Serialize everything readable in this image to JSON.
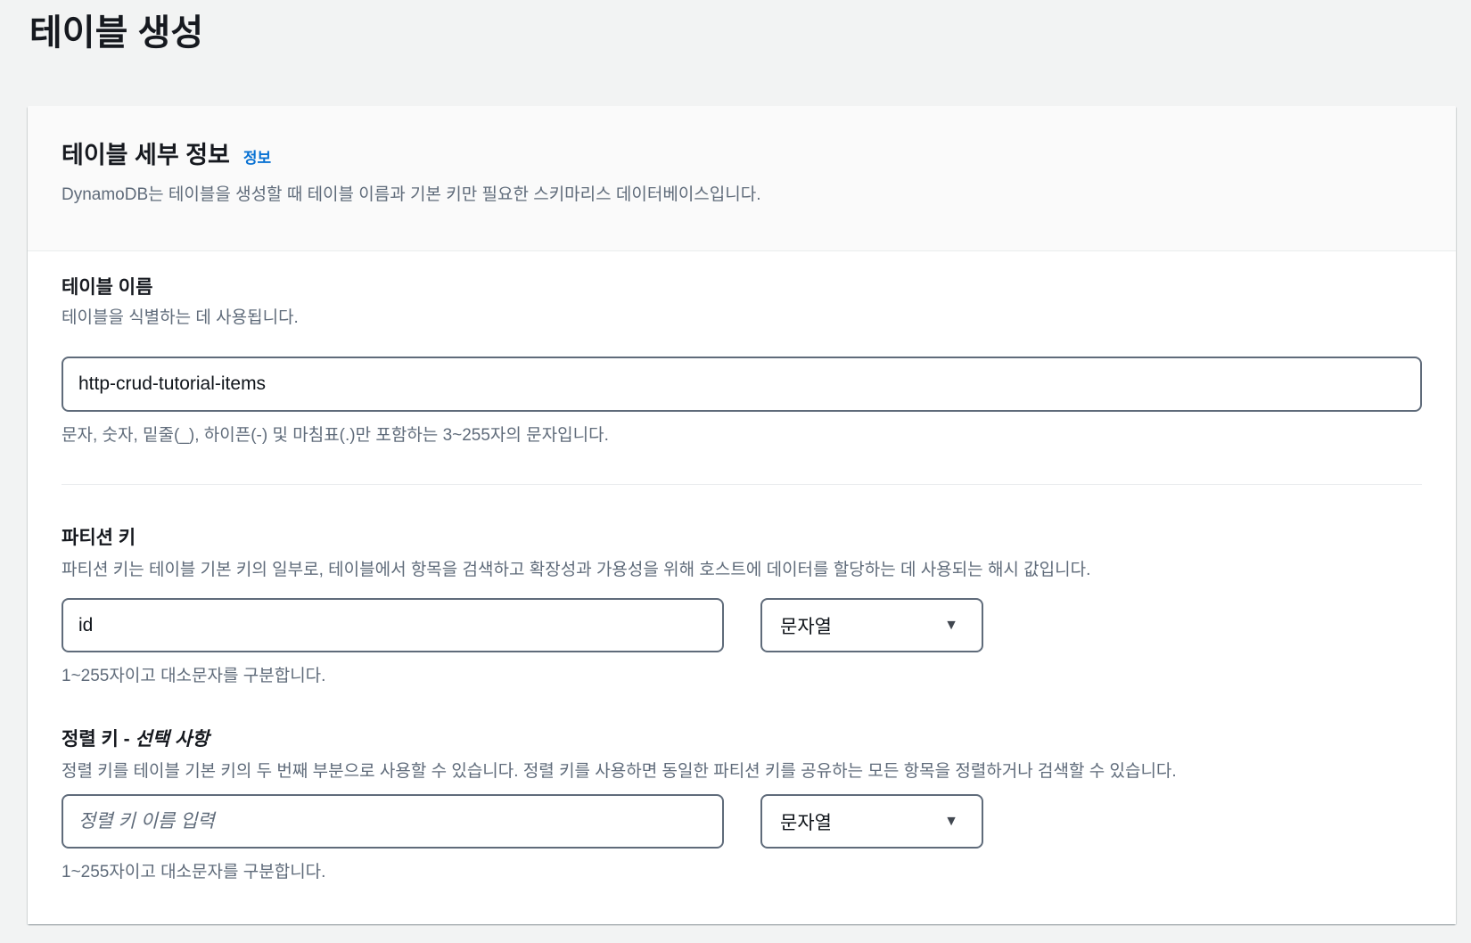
{
  "page": {
    "title": "테이블 생성"
  },
  "panel": {
    "header": {
      "title": "테이블 세부 정보",
      "info_link": "정보",
      "description": "DynamoDB는 테이블을 생성할 때 테이블 이름과 기본 키만 필요한 스키마리스 데이터베이스입니다."
    },
    "table_name": {
      "label": "테이블 이름",
      "hint": "테이블을 식별하는 데 사용됩니다.",
      "value": "http-crud-tutorial-items",
      "constraint": "문자, 숫자, 밑줄(_), 하이픈(-) 및 마침표(.)만 포함하는 3~255자의 문자입니다."
    },
    "partition_key": {
      "label": "파티션 키",
      "description": "파티션 키는 테이블 기본 키의 일부로, 테이블에서 항목을 검색하고 확장성과 가용성을 위해 호스트에 데이터를 할당하는 데 사용되는 해시 값입니다.",
      "value": "id",
      "type_selected": "문자열",
      "constraint": "1~255자이고 대소문자를 구분합니다."
    },
    "sort_key": {
      "label": "정렬 키 - ",
      "optional_label": "선택 사항",
      "description": "정렬 키를 테이블 기본 키의 두 번째 부분으로 사용할 수 있습니다. 정렬 키를 사용하면 동일한 파티션 키를 공유하는 모든 항목을 정렬하거나 검색할 수 있습니다.",
      "placeholder": "정렬 키 이름 입력",
      "type_selected": "문자열",
      "constraint": "1~255자이고 대소문자를 구분합니다."
    },
    "icons": {
      "dropdown_arrow": "▼"
    },
    "colors": {
      "link_blue": "#0972d3",
      "input_border": "#5f6b7a",
      "page_background": "#f2f3f3",
      "header_background": "#fafafa"
    }
  }
}
